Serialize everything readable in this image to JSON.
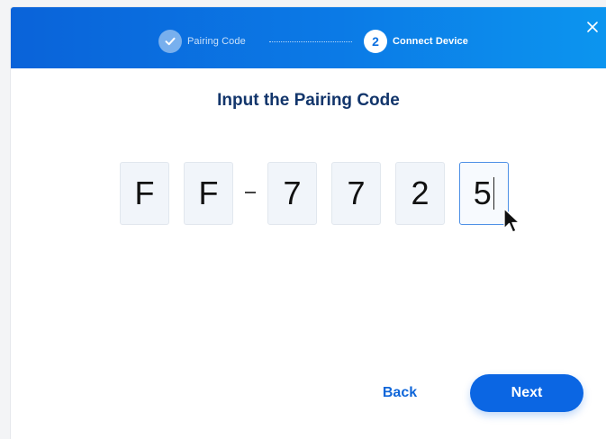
{
  "header": {
    "steps": [
      {
        "label": "Pairing Code",
        "state": "done"
      },
      {
        "number": "2",
        "label": "Connect Device",
        "state": "active"
      }
    ],
    "close_icon": "close-icon"
  },
  "main": {
    "title": "Input the Pairing Code",
    "code": {
      "digits": [
        "F",
        "F",
        "7",
        "7",
        "2",
        "5"
      ],
      "separator": "-",
      "focused_index": 5
    }
  },
  "footer": {
    "back_label": "Back",
    "next_label": "Next"
  },
  "colors": {
    "accent": "#0b66e3",
    "header_gradient_start": "#0a63d9",
    "header_gradient_end": "#0c95ef",
    "title": "#12356b"
  }
}
